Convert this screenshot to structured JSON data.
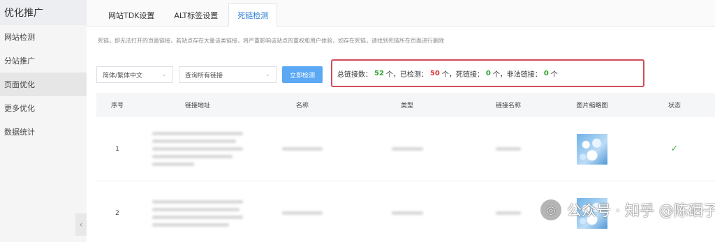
{
  "sidebar": {
    "title": "优化推广",
    "items": [
      {
        "label": "网站检测"
      },
      {
        "label": "分站推广"
      },
      {
        "label": "页面优化"
      },
      {
        "label": "更多优化"
      },
      {
        "label": "数据统计"
      }
    ],
    "collapse_glyph": "‹"
  },
  "tabs": [
    {
      "label": "网站TDK设置"
    },
    {
      "label": "ALT标签设置"
    },
    {
      "label": "死链检测"
    }
  ],
  "description": "死链，即无法打开的页面链接，若站点存在大量该类链接，将严重影响该站点的重权和用户体验，如存在死链，请找到死链所在页面进行删除",
  "toolbar": {
    "language_select": "简体/繁体中文",
    "filter_select": "查询所有链接",
    "check_button": "立即检测",
    "chevron": "⌄"
  },
  "stats": {
    "total_label": "总链接数：",
    "total_value": "52",
    "unit1": "个，已检测：",
    "checked_value": "50",
    "unit2": "个，死链接：",
    "dead_value": "0",
    "unit3": "个，非法链接：",
    "illegal_value": "0",
    "unit4": "个",
    "colors": {
      "total": "#2ea02e",
      "checked": "#dd3333",
      "dead": "#2ea02e",
      "illegal": "#2ea02e",
      "border": "#d14b5a"
    }
  },
  "table": {
    "headers": [
      "序号",
      "链接地址",
      "名称",
      "类型",
      "链接名称",
      "图片缩略图",
      "状态"
    ],
    "rows": [
      {
        "index": "1",
        "status_icon": "✓"
      },
      {
        "index": "2",
        "status_icon": ""
      }
    ]
  },
  "watermark": {
    "logo_glyph": "◎",
    "text": "公众号 · 知乎 @陈硒子"
  }
}
